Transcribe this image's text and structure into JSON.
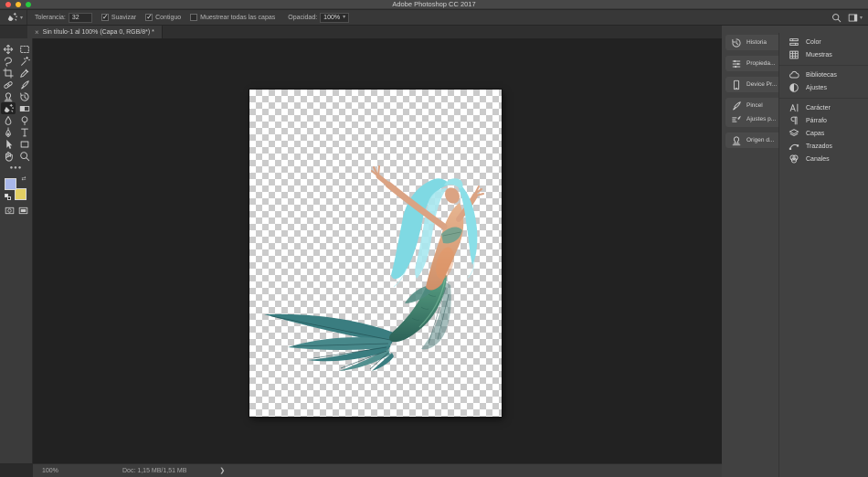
{
  "window": {
    "title": "Adobe Photoshop CC 2017"
  },
  "options_bar": {
    "tool_icon": "magic-eraser",
    "tolerance_label": "Tolerancia:",
    "tolerance_value": "32",
    "checkboxes": [
      {
        "id": "suavizar",
        "label": "Suavizar",
        "checked": true
      },
      {
        "id": "contiguo",
        "label": "Contiguo",
        "checked": true
      },
      {
        "id": "muestrear-todas-las-capas",
        "label": "Muestrear todas las capas",
        "checked": false
      }
    ],
    "opacity_label": "Opacidad:",
    "opacity_value": "100%"
  },
  "tab": {
    "close_glyph": "×",
    "title": "Sin título-1 al 100% (Capa 0, RGB/8*) *"
  },
  "toolbar": {
    "more_glyph": "●●●",
    "foreground_color": "#a9b7e9",
    "background_color": "#e2cf63",
    "tools": [
      {
        "id": "move",
        "icon": "move"
      },
      {
        "id": "marquee",
        "icon": "marquee"
      },
      {
        "id": "lasso",
        "icon": "lasso"
      },
      {
        "id": "magic-wand",
        "icon": "magic-wand"
      },
      {
        "id": "crop",
        "icon": "crop"
      },
      {
        "id": "eyedropper",
        "icon": "eyedropper"
      },
      {
        "id": "healing-brush",
        "icon": "healing-brush"
      },
      {
        "id": "brush",
        "icon": "brush"
      },
      {
        "id": "clone-stamp",
        "icon": "clone-stamp"
      },
      {
        "id": "history-brush",
        "icon": "history-brush"
      },
      {
        "id": "magic-eraser",
        "icon": "magic-eraser",
        "selected": true
      },
      {
        "id": "gradient",
        "icon": "gradient"
      },
      {
        "id": "blur",
        "icon": "blur"
      },
      {
        "id": "dodge",
        "icon": "dodge"
      },
      {
        "id": "pen",
        "icon": "pen"
      },
      {
        "id": "type",
        "icon": "type"
      },
      {
        "id": "path-selection",
        "icon": "path-selection"
      },
      {
        "id": "rectangle",
        "icon": "rectangle"
      },
      {
        "id": "hand",
        "icon": "hand"
      },
      {
        "id": "zoom",
        "icon": "zoom"
      }
    ]
  },
  "panels": {
    "left_groups": [
      [
        {
          "id": "historia",
          "icon": "history",
          "label": "Historia"
        }
      ],
      [
        {
          "id": "propiedades",
          "icon": "properties",
          "label": "Propieda..."
        }
      ],
      [
        {
          "id": "device-preview",
          "icon": "device-preview",
          "label": "Device Pr..."
        }
      ],
      [
        {
          "id": "pincel",
          "icon": "brush",
          "label": "Pincel"
        },
        {
          "id": "ajustes-pincel",
          "icon": "brush-presets",
          "label": "Ajustes p..."
        }
      ],
      [
        {
          "id": "origen-duplicar",
          "icon": "clone-source",
          "label": "Origen d..."
        }
      ]
    ],
    "right_groups": [
      [
        {
          "id": "color",
          "icon": "color",
          "label": "Color"
        },
        {
          "id": "muestras",
          "icon": "swatches",
          "label": "Muestras"
        }
      ],
      [
        {
          "id": "bibliotecas",
          "icon": "libraries",
          "label": "Bibliotecas"
        },
        {
          "id": "ajustes",
          "icon": "adjustments",
          "label": "Ajustes"
        }
      ],
      [
        {
          "id": "caracter",
          "icon": "character",
          "label": "Carácter"
        },
        {
          "id": "parrafo",
          "icon": "paragraph",
          "label": "Párrafo"
        },
        {
          "id": "capas",
          "icon": "layers",
          "label": "Capas"
        },
        {
          "id": "trazados",
          "icon": "paths",
          "label": "Trazados"
        },
        {
          "id": "canales",
          "icon": "channels",
          "label": "Canales"
        }
      ]
    ]
  },
  "status_bar": {
    "zoom": "100%",
    "doc_info": "Doc: 1,15 MB/1,51 MB",
    "chevron": "❯"
  },
  "canvas": {
    "artwork": "mermaid"
  }
}
